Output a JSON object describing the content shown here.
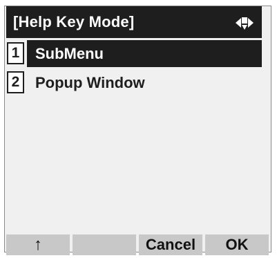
{
  "title_bar": {
    "title": "[Help Key Mode]",
    "nav_icon": "up-down-left-right-nav-icon"
  },
  "menu": {
    "items": [
      {
        "number": "1",
        "label": "SubMenu",
        "selected": true
      },
      {
        "number": "2",
        "label": "Popup Window",
        "selected": false
      }
    ]
  },
  "softkeys": {
    "key1": "↑",
    "key2": "",
    "key3": "Cancel",
    "key4": "OK"
  },
  "colors": {
    "background": "#f0f0f0",
    "title_bar": "#1e1e1e",
    "selected_item": "#1e1e1e",
    "softkey": "#c8c8c8"
  }
}
